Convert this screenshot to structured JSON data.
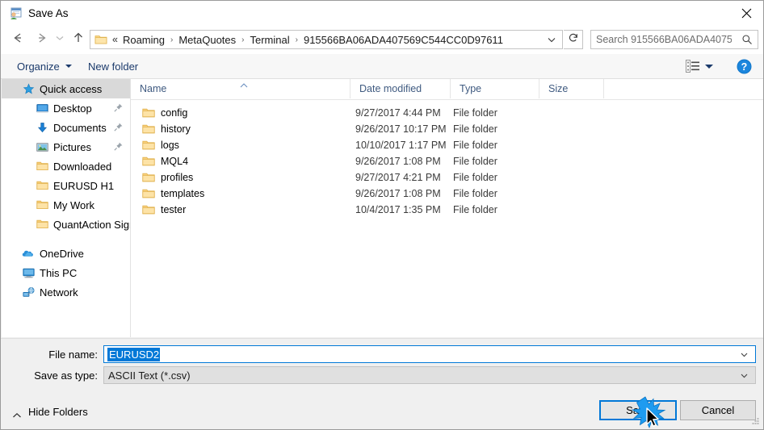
{
  "window": {
    "title": "Save As",
    "app_icon": "save-as-icon",
    "close_icon": "close-icon"
  },
  "nav": {
    "back_icon": "arrow-left-icon",
    "forward_icon": "arrow-right-icon",
    "recent_icon": "chevron-down-icon",
    "up_icon": "arrow-up-icon",
    "refresh_icon": "refresh-icon",
    "breadcrumb_overflow": "«",
    "crumbs": [
      "Roaming",
      "MetaQuotes",
      "Terminal",
      "915566BA06ADA407569C544CC0D97611"
    ],
    "separator": "›",
    "dropdown_icon": "chevron-down-icon"
  },
  "search": {
    "placeholder": "Search 915566BA06ADA40756...",
    "value": "",
    "icon": "search-icon"
  },
  "toolbar": {
    "organize_label": "Organize",
    "new_folder_label": "New folder",
    "view_icon": "view-layout-icon",
    "view_caret_icon": "chevron-down-icon",
    "help_icon": "help-icon"
  },
  "sidebar": {
    "items": [
      {
        "label": "Quick access",
        "icon": "star-icon",
        "selected": true,
        "level": 0,
        "pinned": false
      },
      {
        "label": "Desktop",
        "icon": "desktop-icon",
        "selected": false,
        "level": 1,
        "pinned": true
      },
      {
        "label": "Documents",
        "icon": "documents-icon",
        "selected": false,
        "level": 1,
        "pinned": true
      },
      {
        "label": "Pictures",
        "icon": "pictures-icon",
        "selected": false,
        "level": 1,
        "pinned": true
      },
      {
        "label": "Downloaded",
        "icon": "folder-icon",
        "selected": false,
        "level": 1,
        "pinned": false
      },
      {
        "label": "EURUSD H1",
        "icon": "folder-icon",
        "selected": false,
        "level": 1,
        "pinned": false
      },
      {
        "label": "My Work",
        "icon": "folder-icon",
        "selected": false,
        "level": 1,
        "pinned": false
      },
      {
        "label": "QuantAction Signal",
        "icon": "folder-icon",
        "selected": false,
        "level": 1,
        "pinned": false
      },
      {
        "label": "OneDrive",
        "icon": "onedrive-icon",
        "selected": false,
        "level": 0,
        "pinned": false
      },
      {
        "label": "This PC",
        "icon": "this-pc-icon",
        "selected": false,
        "level": 0,
        "pinned": false
      },
      {
        "label": "Network",
        "icon": "network-icon",
        "selected": false,
        "level": 0,
        "pinned": false
      }
    ]
  },
  "filelist": {
    "columns": [
      "Name",
      "Date modified",
      "Type",
      "Size"
    ],
    "sort_column": "Name",
    "sort_direction": "ascending",
    "rows": [
      {
        "name": "config",
        "date": "9/27/2017 4:44 PM",
        "type": "File folder",
        "size": ""
      },
      {
        "name": "history",
        "date": "9/26/2017 10:17 PM",
        "type": "File folder",
        "size": ""
      },
      {
        "name": "logs",
        "date": "10/10/2017 1:17 PM",
        "type": "File folder",
        "size": ""
      },
      {
        "name": "MQL4",
        "date": "9/26/2017 1:08 PM",
        "type": "File folder",
        "size": ""
      },
      {
        "name": "profiles",
        "date": "9/27/2017 4:21 PM",
        "type": "File folder",
        "size": ""
      },
      {
        "name": "templates",
        "date": "9/26/2017 1:08 PM",
        "type": "File folder",
        "size": ""
      },
      {
        "name": "tester",
        "date": "10/4/2017 1:35 PM",
        "type": "File folder",
        "size": ""
      }
    ]
  },
  "form": {
    "filename_label": "File name:",
    "filename_value": "EURUSD2",
    "savetype_label": "Save as type:",
    "savetype_value": "ASCII Text (*.csv)",
    "dropdown_icon": "chevron-down-icon"
  },
  "footer": {
    "hide_folders_label": "Hide Folders",
    "hide_folders_icon": "chevron-up-icon",
    "save_label": "Save",
    "cancel_label": "Cancel",
    "resize_grip_icon": "resize-grip-icon",
    "cursor_icon": "mouse-pointer-icon",
    "click_effect_icon": "click-burst-icon"
  },
  "colors": {
    "accent": "#0078d7",
    "window_bg": "#f0f0f0",
    "list_bg": "#ffffff",
    "selection": "#d9d9d9",
    "folder_yellow": "#fbd78b",
    "link_blue": "#1b3a6b"
  }
}
